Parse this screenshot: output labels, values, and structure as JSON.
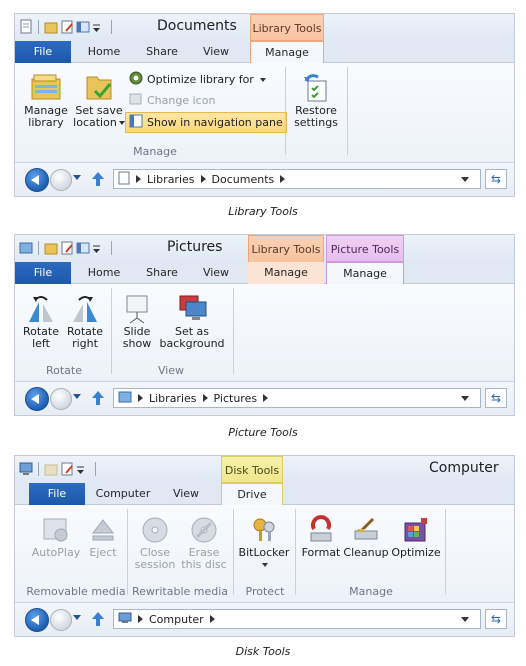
{
  "panels": {
    "library": {
      "window_title": "Documents",
      "context_tab": "Library Tools",
      "tabs": {
        "file": "File",
        "home": "Home",
        "share": "Share",
        "view": "View",
        "manage": "Manage"
      },
      "buttons": {
        "manage_library": [
          "Manage",
          "library"
        ],
        "set_save_location": [
          "Set save",
          "location"
        ],
        "optimize_library": "Optimize library for",
        "change_icon": "Change icon",
        "show_in_nav": "Show in navigation pane",
        "restore_settings": [
          "Restore",
          "settings"
        ]
      },
      "group_label": "Manage",
      "address": [
        "Libraries",
        "Documents"
      ],
      "caption": "Library Tools"
    },
    "picture": {
      "window_title": "Pictures",
      "context_tabs": [
        "Library Tools",
        "Picture Tools"
      ],
      "tabs": {
        "file": "File",
        "home": "Home",
        "share": "Share",
        "view": "View",
        "manage1": "Manage",
        "manage2": "Manage"
      },
      "buttons": {
        "rotate_left": [
          "Rotate",
          "left"
        ],
        "rotate_right": [
          "Rotate",
          "right"
        ],
        "slide_show": [
          "Slide",
          "show"
        ],
        "set_as_background": [
          "Set as",
          "background"
        ]
      },
      "groups": [
        "Rotate",
        "View"
      ],
      "address": [
        "Libraries",
        "Pictures"
      ],
      "caption": "Picture Tools"
    },
    "disk": {
      "window_title": "Computer",
      "context_tab": "Disk Tools",
      "tabs": {
        "file": "File",
        "computer": "Computer",
        "view": "View",
        "drive": "Drive"
      },
      "buttons": {
        "autoplay": "AutoPlay",
        "eject": "Eject",
        "close_session": [
          "Close",
          "session"
        ],
        "erase_disc": [
          "Erase",
          "this disc"
        ],
        "bitlocker": "BitLocker",
        "format": "Format",
        "cleanup": "Cleanup",
        "optimize": "Optimize"
      },
      "groups": [
        "Removable media",
        "Rewritable media",
        "Protect",
        "Manage"
      ],
      "address": [
        "Computer"
      ],
      "caption": "Disk Tools"
    }
  },
  "colors": {
    "file_tab": "#1c58ab",
    "library_tools": "#f8c3a0",
    "picture_tools": "#e6bdee",
    "disk_tools": "#eee68c",
    "highlight": "#fbd77d"
  }
}
